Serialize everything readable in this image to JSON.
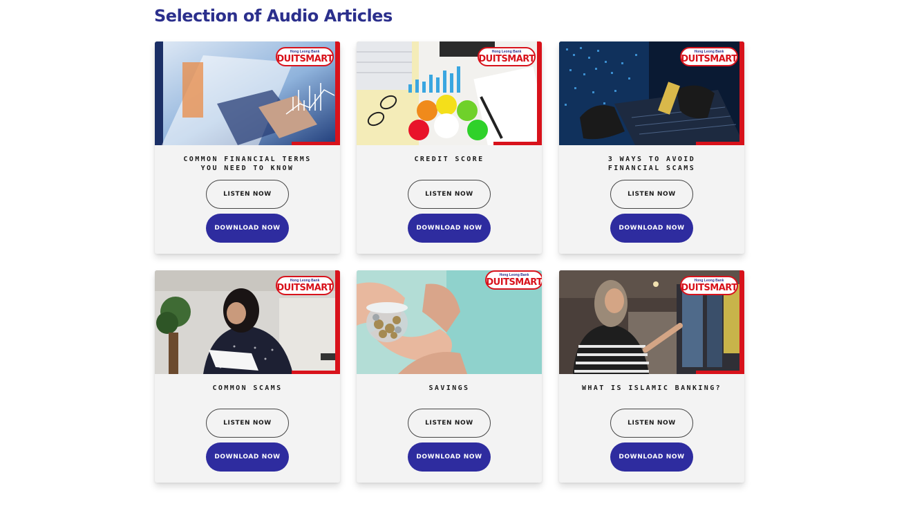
{
  "page": {
    "heading": "Selection of Audio Articles"
  },
  "brand": {
    "logo_small": "Hong Leong Bank",
    "logo_main": "DUITSMART",
    "accent": "#d8121b",
    "primary": "#2e2c9f"
  },
  "buttons": {
    "listen": "LISTEN NOW",
    "download": "DOWNLOAD NOW"
  },
  "articles": [
    {
      "title": "COMMON FINANCIAL TERMS\nYOU NEED TO KNOW",
      "image": "tablet-chart-image"
    },
    {
      "title": "CREDIT SCORE",
      "image": "credit-score-image"
    },
    {
      "title": "3 WAYS TO AVOID\nFINANCIAL SCAMS",
      "image": "hacker-laptop-image"
    },
    {
      "title": "COMMON SCAMS",
      "image": "stressed-woman-image"
    },
    {
      "title": "SAVINGS",
      "image": "coin-jar-image"
    },
    {
      "title": "WHAT IS ISLAMIC BANKING?",
      "image": "atm-woman-image"
    }
  ]
}
